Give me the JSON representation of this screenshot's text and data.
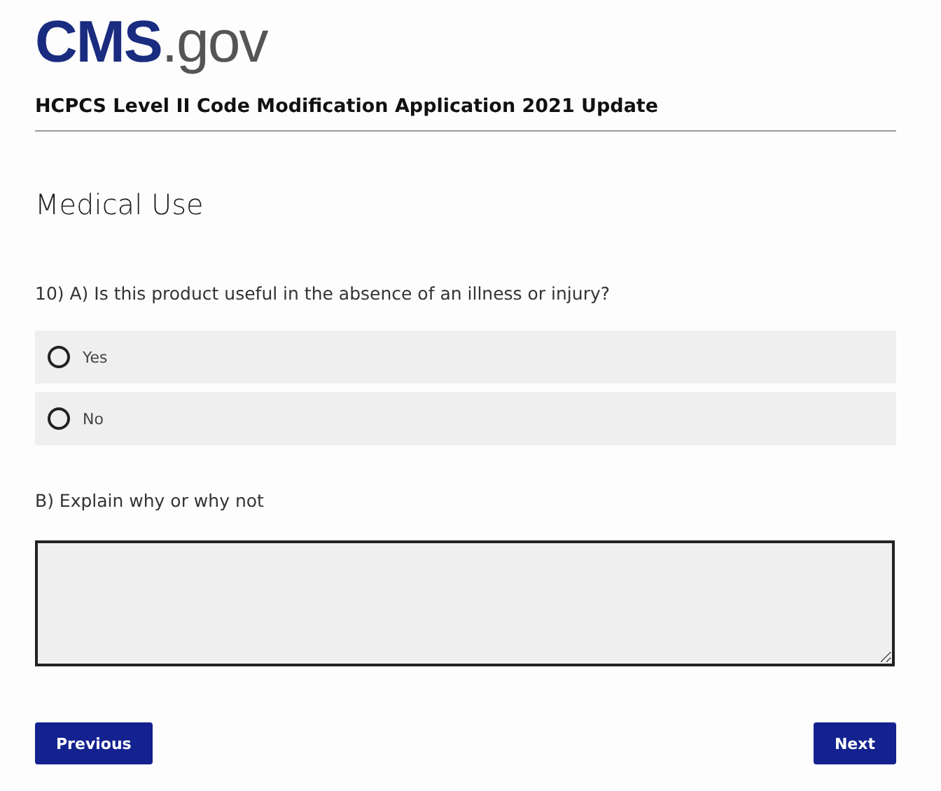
{
  "logo": {
    "brand": "CMS",
    "suffix": ".gov"
  },
  "form_title": "HCPCS Level II Code Modification Application 2021 Update",
  "section_heading": "Medical Use",
  "question_a": "10) A) Is this product useful in the absence of an illness or injury?",
  "options": [
    {
      "label": "Yes",
      "selected": false
    },
    {
      "label": "No",
      "selected": false
    }
  ],
  "question_b": "B) Explain why or why not",
  "buttons": [
    "Previous",
    "Next"
  ]
}
